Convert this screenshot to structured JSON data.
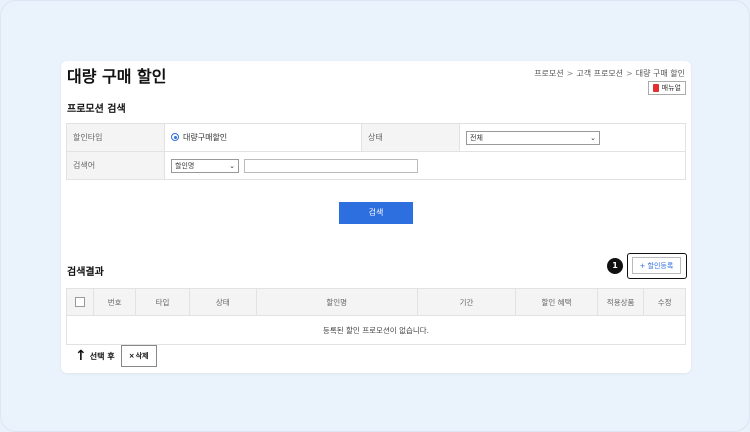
{
  "page": {
    "title": "대량 구매 할인",
    "breadcrumb": [
      "프로모션",
      "고객 프로모션",
      "대량 구매 할인"
    ],
    "breadcrumb_sep": ">",
    "manual_label": "매뉴얼"
  },
  "search": {
    "section_title": "프로모션 검색",
    "discount_type_label": "할인타입",
    "discount_type_value": "대량구매할인",
    "status_label": "상태",
    "status_value": "전체",
    "keyword_label": "검색어",
    "keyword_select": "할인명",
    "search_button": "검색"
  },
  "results": {
    "section_title": "검색결과",
    "add_button": "할인등록",
    "add_plus": "+",
    "step_badge": "1",
    "columns": [
      "번호",
      "타입",
      "상태",
      "할인명",
      "기간",
      "할인 혜택",
      "적용상품",
      "수정"
    ],
    "empty_message": "등록된 할인 프로모션이 없습니다.",
    "after_select_label": "선택 후",
    "delete_button": "삭제",
    "delete_x": "×"
  },
  "colors": {
    "accent": "#2e6fdf",
    "background": "#eaf2fc",
    "pdf": "#e03030"
  }
}
